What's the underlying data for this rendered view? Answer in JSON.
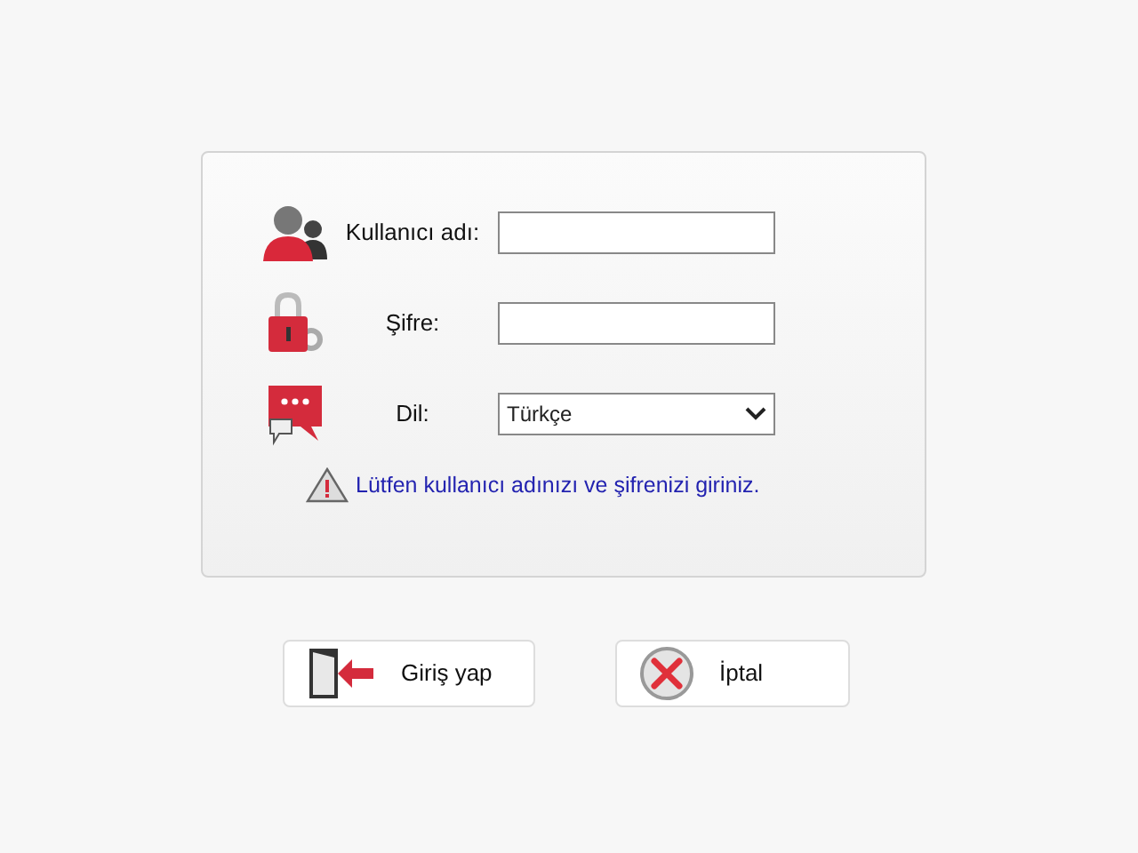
{
  "form": {
    "fields": [
      {
        "kind": "text",
        "label": "Kullanıcı adı:"
      },
      {
        "kind": "password",
        "label": "Şifre:"
      },
      {
        "kind": "select",
        "label": "Dil:",
        "value": "Türkçe"
      }
    ],
    "message": "Lütfen kullanıcı adınızı ve şifrenizi giriniz."
  },
  "buttons": [
    {
      "kind": "login",
      "label": "Giriş yap"
    },
    {
      "kind": "cancel",
      "label": "İptal"
    }
  ]
}
